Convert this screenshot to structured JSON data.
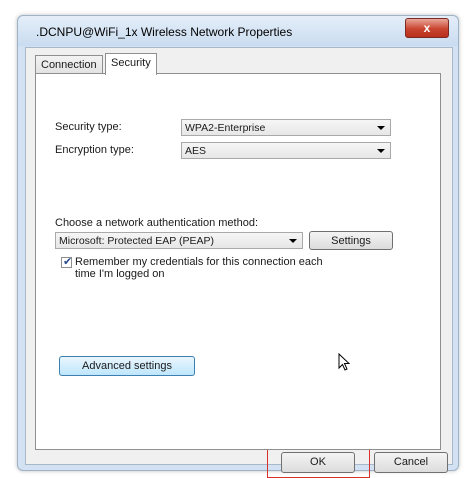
{
  "window": {
    "title": ".DCNPU@WiFi_1x Wireless Network Properties",
    "close_label": "x"
  },
  "tabs": [
    {
      "label": "Connection",
      "active": false
    },
    {
      "label": "Security",
      "active": true
    }
  ],
  "security": {
    "security_type_label": "Security type:",
    "security_type_value": "WPA2-Enterprise",
    "encryption_type_label": "Encryption type:",
    "encryption_type_value": "AES",
    "auth_method_label": "Choose a network authentication method:",
    "auth_method_value": "Microsoft: Protected EAP (PEAP)",
    "settings_label": "Settings",
    "remember_label_line1": "Remember my credentials for this connection each",
    "remember_label_line2": "time I'm logged on",
    "remember_checked": true,
    "advanced_label": "Advanced settings"
  },
  "footer": {
    "ok_label": "OK",
    "cancel_label": "Cancel"
  }
}
